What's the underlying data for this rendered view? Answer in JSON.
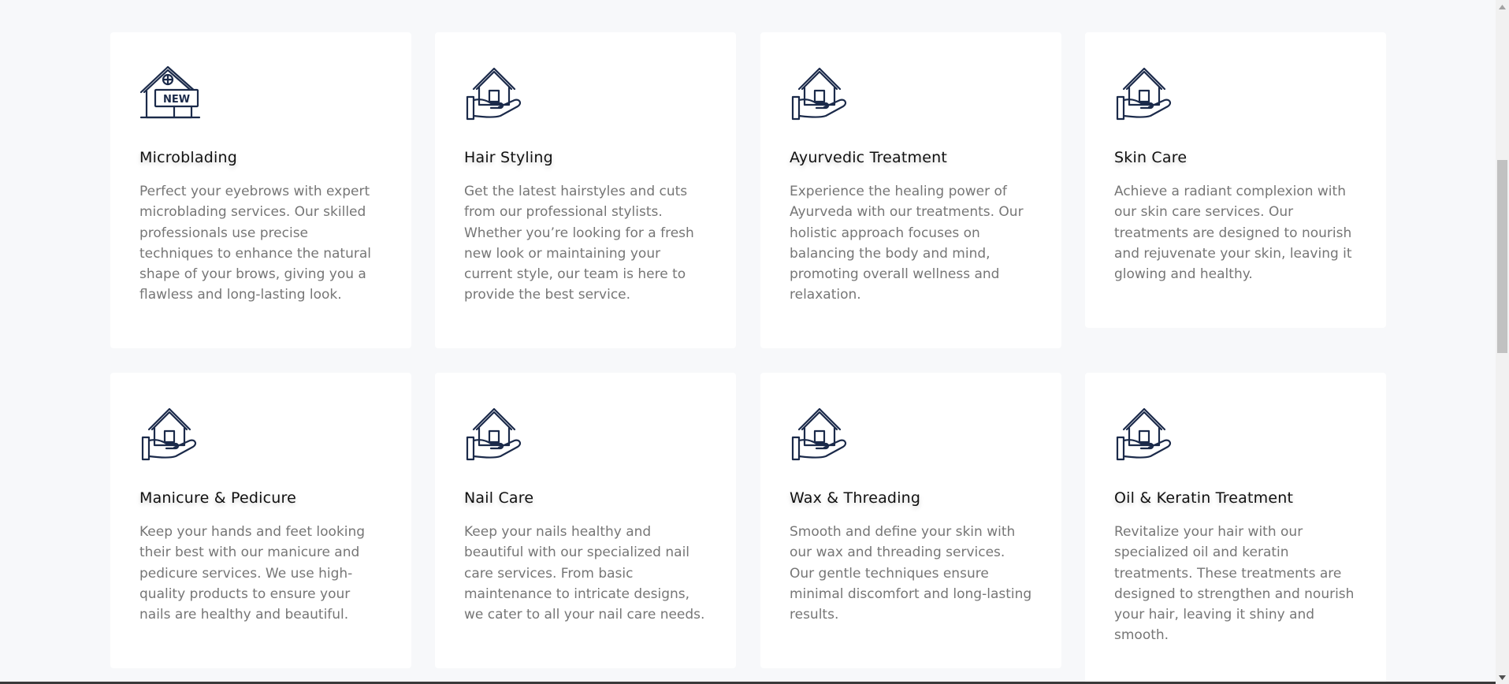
{
  "services": [
    {
      "icon": "new-house-sign-icon",
      "title": "Microblading",
      "description": "Perfect your eyebrows with expert microblading services. Our skilled professionals use precise techniques to enhance the natural shape of your brows, giving you a flawless and long-lasting look."
    },
    {
      "icon": "house-in-hand-icon",
      "title": "Hair Styling",
      "description": "Get the latest hairstyles and cuts from our professional stylists. Whether you’re looking for a fresh new look or maintaining your current style, our team is here to provide the best service."
    },
    {
      "icon": "house-in-hand-icon",
      "title": "Ayurvedic Treatment",
      "description": "Experience the healing power of Ayurveda with our treatments. Our holistic approach focuses on balancing the body and mind, promoting overall wellness and relaxation."
    },
    {
      "icon": "house-in-hand-icon",
      "title": "Skin Care",
      "description": "Achieve a radiant complexion with our skin care services. Our treatments are designed to nourish and rejuvenate your skin, leaving it glowing and healthy."
    },
    {
      "icon": "house-in-hand-icon",
      "title": "Manicure & Pedicure",
      "description": "Keep your hands and feet looking their best with our manicure and pedicure services. We use high-quality products to ensure your nails are healthy and beautiful."
    },
    {
      "icon": "house-in-hand-icon",
      "title": "Nail Care",
      "description": "Keep your nails healthy and beautiful with our specialized nail care services. From basic maintenance to intricate designs, we cater to all your nail care needs."
    },
    {
      "icon": "house-in-hand-icon",
      "title": "Wax & Threading",
      "description": "Smooth and define your skin with our wax and threading services. Our gentle techniques ensure minimal discomfort and long-lasting results."
    },
    {
      "icon": "house-in-hand-icon",
      "title": "Oil & Keratin Treatment",
      "description": "Revitalize your hair with our specialized oil and keratin treatments. These treatments are designed to strengthen and nourish your hair, leaving it shiny and smooth."
    }
  ],
  "icon_badge_text": "NEW",
  "colors": {
    "page_background": "#f7f8fa",
    "card_background": "#ffffff",
    "icon_stroke": "#1b2a4a",
    "title": "#111111",
    "description": "#767676"
  }
}
